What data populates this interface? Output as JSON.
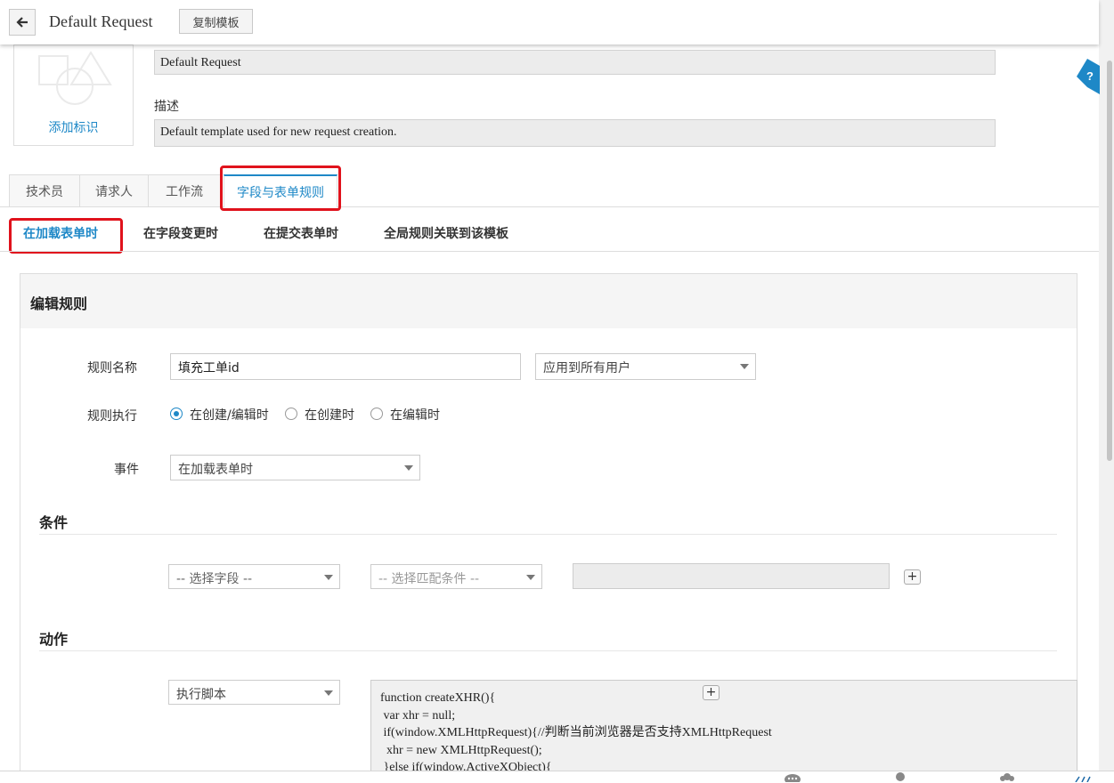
{
  "header": {
    "title": "Default Request",
    "copy_template_label": "复制模板"
  },
  "template": {
    "add_icon_label": "添加标识",
    "name_value": "Default Request",
    "description_label": "描述",
    "description_value": "Default template used for new request creation."
  },
  "tabs": [
    {
      "label": "技术员"
    },
    {
      "label": "请求人"
    },
    {
      "label": "工作流"
    },
    {
      "label": "字段与表单规则",
      "active": true
    }
  ],
  "subtabs": [
    {
      "label": "在加载表单时",
      "active": true
    },
    {
      "label": "在字段变更时"
    },
    {
      "label": "在提交表单时"
    },
    {
      "label": "全局规则关联到该模板"
    }
  ],
  "rule": {
    "panel_title": "编辑规则",
    "name_label": "规则名称",
    "name_value": "填充工单id",
    "apply_to_value": "应用到所有用户",
    "execute_label": "规则执行",
    "execute_options": [
      {
        "label": "在创建/编辑时",
        "checked": true
      },
      {
        "label": "在创建时",
        "checked": false
      },
      {
        "label": "在编辑时",
        "checked": false
      }
    ],
    "event_label": "事件",
    "event_value": "在加载表单时"
  },
  "conditions": {
    "title": "条件",
    "field_placeholder": "-- 选择字段 --",
    "match_placeholder": "-- 选择匹配条件 --",
    "value": ""
  },
  "actions": {
    "title": "动作",
    "action_type": "执行脚本",
    "script": "function createXHR(){\n var xhr = null;\n if(window.XMLHttpRequest){//判断当前浏览器是否支持XMLHttpRequest\n  xhr = new XMLHttpRequest();\n }else if(window.ActiveXObject){"
  },
  "colors": {
    "accent": "#1e88c7",
    "highlight": "#e0121c"
  },
  "icons": [
    "back-arrow-icon",
    "placeholder-shapes-icon",
    "help-icon",
    "plus-icon",
    "chevron-down-icon",
    "chat-icon",
    "user-icon",
    "group-icon"
  ]
}
